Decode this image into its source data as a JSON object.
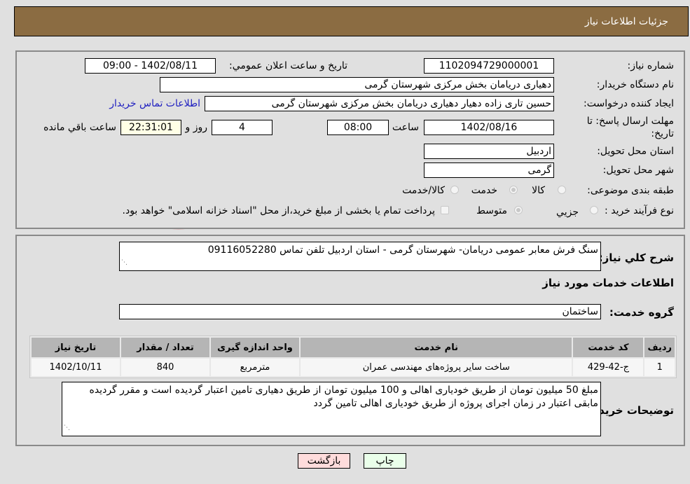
{
  "header": {
    "title": "جزئيات اطلاعات نياز"
  },
  "details": {
    "need_number_label": "شماره نياز:",
    "need_number": "1102094729000001",
    "announce_label": "تاريخ و ساعت اعلان عمومي:",
    "announce_value": "1402/08/11 - 09:00",
    "buyer_org_label": "نام دستگاه خريدار:",
    "buyer_org": "دهیاری دریامان بخش مرکزی شهرستان گرمی",
    "requester_label": "ايجاد کننده درخواست:",
    "requester": "حسین تاری زاده دهیار دهیاری دریامان بخش مرکزی شهرستان گرمی",
    "contact_link": "اطلاعات تماس خريدار",
    "deadline_label": "مهلت ارسال پاسخ: تا تاريخ:",
    "deadline_date": "1402/08/16",
    "time_label": "ساعت",
    "deadline_time": "08:00",
    "days_value": "4",
    "days_label": "روز و",
    "remaining_time": "22:31:01",
    "remaining_label": "ساعت باقي مانده",
    "province_label": "استان محل تحويل:",
    "province": "اردبیل",
    "city_label": "شهر محل تحويل:",
    "city": "گرمی",
    "category_label": "طبقه بندی موضوعی:",
    "category_options": [
      {
        "label": "کالا",
        "selected": false
      },
      {
        "label": "خدمت",
        "selected": true
      },
      {
        "label": "کالا/خدمت",
        "selected": false
      }
    ],
    "purchase_type_label": "نوع فرآيند خريد :",
    "purchase_options": [
      {
        "label": "جزيي",
        "selected": false
      },
      {
        "label": "متوسط",
        "selected": true
      }
    ],
    "treasury_note": "پرداخت تمام يا بخشی از مبلغ خريد،از محل \"اسناد خزانه اسلامی\" خواهد بود."
  },
  "summary": {
    "description_label": "شرح كلي نياز:",
    "description": "سنگ فرش معابر عمومی دریامان- شهرستان گرمی - استان اردبیل تلفن تماس 09116052280",
    "services_heading": "اطلاعات خدمات مورد نياز",
    "service_group_label": "گروه خدمت:",
    "service_group": "ساختمان"
  },
  "table": {
    "columns": [
      "رديف",
      "کد خدمت",
      "نام خدمت",
      "واحد اندازه گيری",
      "تعداد / مقدار",
      "تاريخ نياز"
    ],
    "rows": [
      [
        "1",
        "ج-42-429",
        "ساخت سایر پروژه‌های مهندسی عمران",
        "مترمربع",
        "840",
        "1402/10/11"
      ]
    ]
  },
  "buyer_notes": {
    "label": "توضيحات خريدار:",
    "text": "مبلغ 50 میلیون تومان از طریق خودیاری اهالی و 100 میلیون تومان از طریق دهیاری تامین اعتبار گردیده است و مقرر گردیده مابقی اعتبار در زمان اجرای پروژه از طریق خودیاری اهالی تامین گردد"
  },
  "buttons": {
    "print": "چاپ",
    "back": "بازگشت"
  },
  "colors": {
    "header": "#8b6c42",
    "print_bg": "#eaffea",
    "back_bg": "#ffdcdc",
    "link": "#2020c0"
  },
  "watermark": {
    "text": "AriaTender.neT"
  }
}
